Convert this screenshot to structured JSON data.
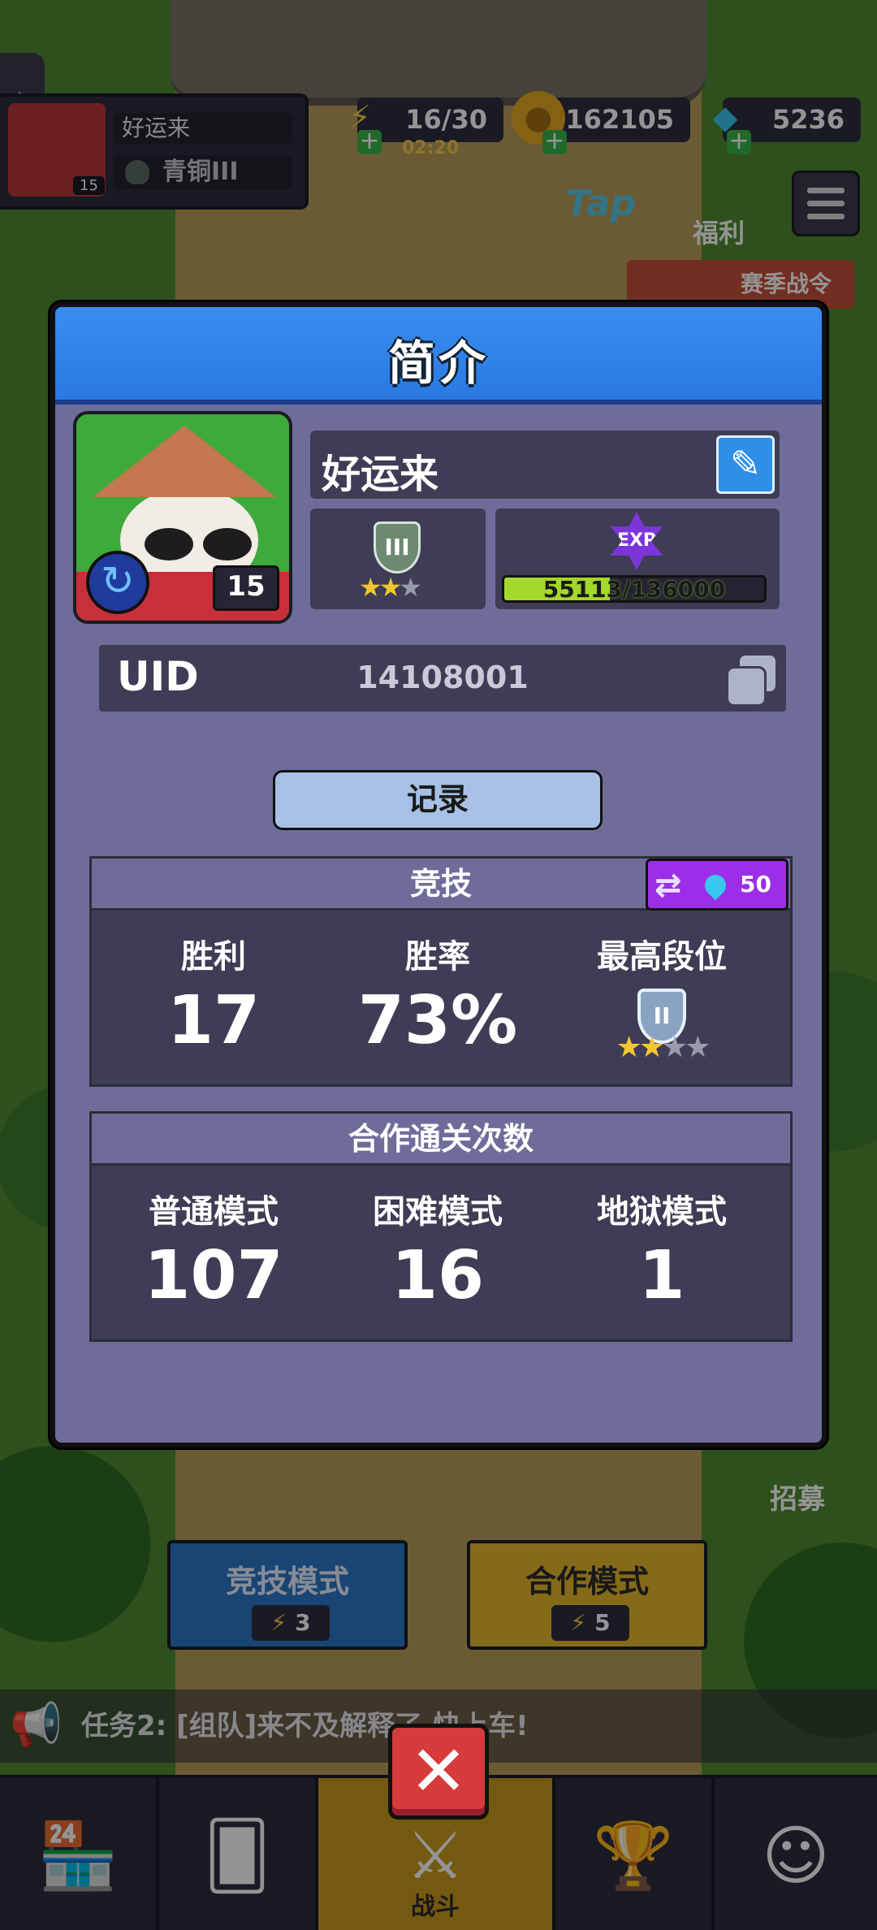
{
  "hud": {
    "player_name": "好运来",
    "player_level": "15",
    "player_rank": "青铜III",
    "energy": "16/30",
    "energy_timer": "02:20",
    "gold": "162105",
    "gems": "5236",
    "tap_label": "Tap",
    "welfare_label": "福利",
    "season_label": "赛季战令"
  },
  "modal": {
    "title": "简介",
    "name": "好运来",
    "level": "15",
    "rank_numeral": "III",
    "rank_stars": 2,
    "exp_label": "EXP",
    "exp_text": "55113/136000",
    "exp_progress": 0.405,
    "uid_label": "UID",
    "uid_value": "14108001",
    "record_button": "记录",
    "competitive": {
      "title": "竞技",
      "swap_cost": "50",
      "stats": [
        {
          "label": "胜利",
          "value": "17"
        },
        {
          "label": "胜率",
          "value": "73%"
        },
        {
          "label": "最高段位",
          "rank_numeral": "II",
          "stars": 2
        }
      ]
    },
    "coop": {
      "title": "合作通关次数",
      "stats": [
        {
          "label": "普通模式",
          "value": "107"
        },
        {
          "label": "困难模式",
          "value": "16"
        },
        {
          "label": "地狱模式",
          "value": "1"
        }
      ]
    }
  },
  "scene": {
    "competitive_mode": "竞技模式",
    "competitive_cost": "3",
    "coop_mode": "合作模式",
    "coop_cost": "5",
    "recruit_label": "招募",
    "task_text": "任务2: [组队]来不及解释了,快上车!",
    "nav_active_label": "战斗"
  },
  "colors": {
    "modal_bg": "#6e6d9a",
    "header_blue": "#2979e1",
    "exp_green": "#a4d82a",
    "swap_purple": "#9b2ee6",
    "close_red": "#d63b3b"
  },
  "icons": [
    "chevron-right-icon",
    "energy-icon",
    "gold-coin-icon",
    "gem-icon",
    "menu-icon",
    "pencil-icon",
    "refresh-icon",
    "copy-icon",
    "swap-icon",
    "announcement-icon",
    "close-icon",
    "shop-icon",
    "cards-icon",
    "battle-icon",
    "trophy-icon",
    "friends-icon"
  ]
}
